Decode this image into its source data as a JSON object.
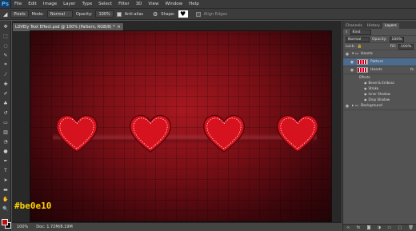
{
  "menubar": {
    "logo": "Ps",
    "items": [
      "File",
      "Edit",
      "Image",
      "Layer",
      "Type",
      "Select",
      "Filter",
      "3D",
      "View",
      "Window",
      "Help"
    ]
  },
  "options": {
    "style_value": "Pixels",
    "mode_label": "Mode:",
    "mode_value": "Normal",
    "opacity_label": "Opacity:",
    "opacity_value": "100%",
    "antialias_label": "Anti-alias",
    "shape_label": "Shape:",
    "align_label": "Align Edges"
  },
  "document": {
    "tab_title": "LOVEly Text Effect.psd @ 100% (Pattern, RGB/8) *",
    "zoom": "100%",
    "doc_info": "Doc: 1.72M/8.19M"
  },
  "foreground_color": "#be0e10",
  "hex_label": "#be0e10",
  "panels": {
    "tabs": [
      "Channels",
      "History",
      "Layers"
    ],
    "kind_label": "Kind",
    "blend_value": "Normal",
    "opacity_label": "Opacity:",
    "opacity_value": "100%",
    "lock_label": "Lock:",
    "fill_label": "Fill:",
    "fill_value": "100%",
    "layers": {
      "group1": "Hearts",
      "pattern": "Pattern",
      "hearts": "Hearts",
      "effects_label": "Effects",
      "effects": [
        "Bevel & Emboss",
        "Stroke",
        "Inner Shadow",
        "Drop Shadow"
      ],
      "background": "Background"
    }
  }
}
